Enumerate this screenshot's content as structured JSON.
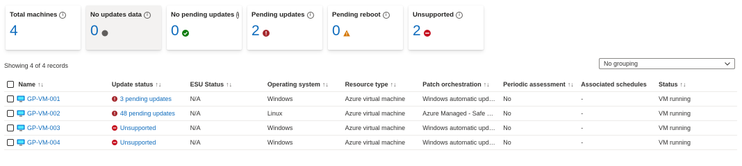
{
  "summary_cards": [
    {
      "title": "Total machines",
      "value": "4",
      "status_icon": "",
      "selected": false
    },
    {
      "title": "No updates data",
      "value": "0",
      "status_icon": "gray-dot-icon",
      "selected": true
    },
    {
      "title": "No pending updates",
      "value": "0",
      "status_icon": "green-check-icon",
      "selected": false
    },
    {
      "title": "Pending updates",
      "value": "2",
      "status_icon": "red-alert-icon",
      "selected": false
    },
    {
      "title": "Pending reboot",
      "value": "0",
      "status_icon": "warning-icon",
      "selected": false
    },
    {
      "title": "Unsupported",
      "value": "2",
      "status_icon": "blocked-icon",
      "selected": false
    }
  ],
  "showing_text": "Showing 4 of 4 records",
  "grouping": {
    "selected": "No grouping"
  },
  "table": {
    "columns": [
      "Name",
      "Update status",
      "ESU Status",
      "Operating system",
      "Resource type",
      "Patch orchestration",
      "Periodic assessment",
      "Associated schedules",
      "Status"
    ],
    "rows": [
      {
        "name": "GP-VM-001",
        "update_status": "3 pending updates",
        "update_icon": "red-alert-icon",
        "esu": "N/A",
        "os": "Windows",
        "resource_type": "Azure virtual machine",
        "patch": "Windows automatic updates",
        "assessment": "No",
        "schedules": "-",
        "status": "VM running"
      },
      {
        "name": "GP-VM-002",
        "update_status": "48 pending updates",
        "update_icon": "red-alert-icon",
        "esu": "N/A",
        "os": "Linux",
        "resource_type": "Azure virtual machine",
        "patch": "Azure Managed - Safe Deployment",
        "assessment": "No",
        "schedules": "-",
        "status": "VM running"
      },
      {
        "name": "GP-VM-003",
        "update_status": "Unsupported",
        "update_icon": "blocked-icon",
        "esu": "N/A",
        "os": "Windows",
        "resource_type": "Azure virtual machine",
        "patch": "Windows automatic updates",
        "assessment": "No",
        "schedules": "-",
        "status": "VM running"
      },
      {
        "name": "GP-VM-004",
        "update_status": "Unsupported",
        "update_icon": "blocked-icon",
        "esu": "N/A",
        "os": "Windows",
        "resource_type": "Azure virtual machine",
        "patch": "Windows automatic updates",
        "assessment": "No",
        "schedules": "-",
        "status": "VM running"
      }
    ]
  },
  "colors": {
    "accent": "#0f6cbd",
    "error": "#a4262c",
    "success": "#107c10",
    "warning": "#d47500",
    "neutral": "#605e5c"
  }
}
